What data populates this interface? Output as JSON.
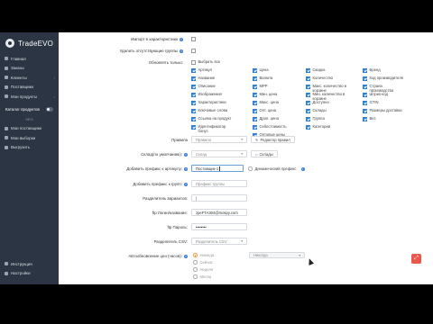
{
  "sidebar": {
    "logo_text": "TradeEVO",
    "items": [
      {
        "label": "Главная",
        "icon": "home-icon"
      },
      {
        "label": "Заказы",
        "icon": "cart-icon"
      },
      {
        "label": "Клиенты",
        "icon": "users-icon",
        "caret": "›"
      },
      {
        "label": "Поставщики",
        "icon": "truck-icon"
      },
      {
        "label": "Мои продукты",
        "icon": "box-icon",
        "caret": "›"
      }
    ],
    "quick_label": "Каталог продуктов",
    "section_label": "SEO",
    "items2": [
      {
        "label": "Мои поставщики",
        "icon": "list-icon"
      },
      {
        "label": "Мои выборки",
        "icon": "filter-icon"
      },
      {
        "label": "Выгрузить",
        "icon": "upload-icon"
      }
    ],
    "bottom_items": [
      {
        "label": "Инструкция",
        "icon": "question-icon"
      },
      {
        "label": "Настройки",
        "icon": "gear-icon"
      }
    ]
  },
  "form": {
    "char_label": "Импорт в характеристики",
    "delete_groups_label": "Удалить отсутствующие группы",
    "update_only_label": "Обновлять только:",
    "update_fields": [
      {
        "label": "Выбрать все",
        "checked": false
      },
      {
        "label": "Артикул",
        "checked": true
      },
      {
        "label": "Название",
        "checked": true
      },
      {
        "label": "Описание",
        "checked": true
      },
      {
        "label": "Изображения",
        "checked": true
      },
      {
        "label": "Характеристики",
        "checked": true
      },
      {
        "label": "Ключевые слова",
        "checked": true
      },
      {
        "label": "Ссылка на продукт",
        "checked": true
      },
      {
        "label": "Идентификатор бонус",
        "checked": true
      },
      {
        "label": "Цена",
        "checked": true
      },
      {
        "label": "Валюта",
        "checked": true
      },
      {
        "label": "МРР",
        "checked": true
      },
      {
        "label": "Мин. цена",
        "checked": true
      },
      {
        "label": "Макс. цена",
        "checked": true
      },
      {
        "label": "Опт. цена",
        "checked": true
      },
      {
        "label": "Дроп. цена",
        "checked": true
      },
      {
        "label": "Себестоимость",
        "checked": true
      },
      {
        "label": "Оптовые цены",
        "checked": true
      },
      {
        "label": "Скидка",
        "checked": true
      },
      {
        "label": "Количество",
        "checked": true
      },
      {
        "label": "Макс. количество в корзине",
        "checked": true
      },
      {
        "label": "Мин. количество в корзине",
        "checked": true
      },
      {
        "label": "Доступно",
        "checked": true
      },
      {
        "label": "Склады",
        "checked": true
      },
      {
        "label": "Группа",
        "checked": true
      },
      {
        "label": "Категории",
        "checked": true
      },
      {
        "label": "Бренд",
        "checked": true
      },
      {
        "label": "Код производителя",
        "checked": true
      },
      {
        "label": "Страна производства",
        "checked": true
      },
      {
        "label": "Штрих-код",
        "checked": true
      },
      {
        "label": "GTIN",
        "checked": true
      },
      {
        "label": "Размеры доставки",
        "checked": true
      },
      {
        "label": "Вес",
        "checked": true
      }
    ],
    "rule_label": "Правила",
    "rule_value": "Правило",
    "rule_button": "Редактор правил",
    "warehouse_label": "Склад(по умолчанию):",
    "warehouse_value": "Склад",
    "warehouse_button": "Склады",
    "prefix_label": "Добавить префикс к артикулу:",
    "prefix_value": "Поставщик-1",
    "dynamic_prefix_label": "Динамический префикс",
    "group_prefix_label": "Добавить префикс к групп:",
    "group_prefix_placeholder": "Префикс группы",
    "separator_label": "Разделитель вариантов:",
    "separator_value": "|",
    "ftp_login_label": "ftp Логин/название:",
    "ftp_login_value": "zpeFTA304@mospy.com",
    "ftp_pass_label": "ftp Пароль:",
    "ftp_pass_value": "••••••••",
    "csv_label": "Разделитель CSV:",
    "csv_placeholder": "Разделитель CSV",
    "autoupdate_label": "Автообновление цен (часов):",
    "autoupdate_options": [
      "Никогда",
      "Сейчас",
      "Неделя",
      "Месяц"
    ],
    "autoupdate_select": "Никогда"
  }
}
